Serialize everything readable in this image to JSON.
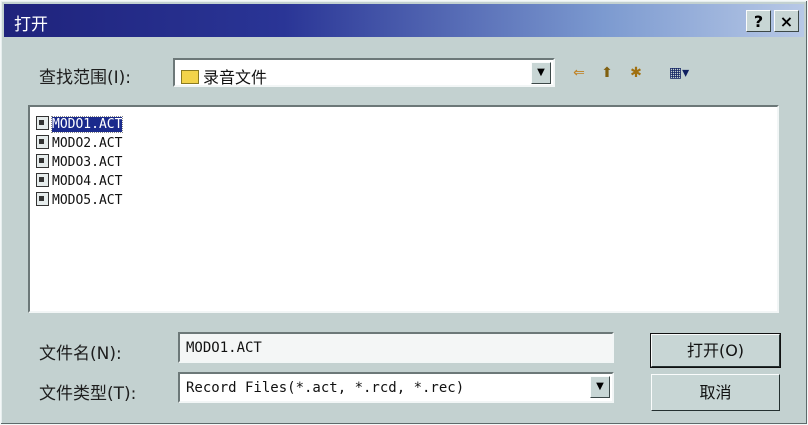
{
  "window": {
    "title": "打开",
    "help_label": "?",
    "close_label": "×"
  },
  "lookin": {
    "label": "查找范围(I):",
    "value": "录音文件",
    "dropdown_glyph": "▼",
    "toolbar": {
      "back_glyph": "⇐",
      "up_glyph": "⬆",
      "newfolder_glyph": "✱",
      "view_glyph": "▦▾"
    }
  },
  "files": [
    {
      "name": "MODO1.ACT",
      "selected": true
    },
    {
      "name": "MODO2.ACT",
      "selected": false
    },
    {
      "name": "MODO3.ACT",
      "selected": false
    },
    {
      "name": "MODO4.ACT",
      "selected": false
    },
    {
      "name": "MODO5.ACT",
      "selected": false
    }
  ],
  "filename": {
    "label": "文件名(N):",
    "value": "MODO1.ACT"
  },
  "filetype": {
    "label": "文件类型(T):",
    "value": "Record Files(*.act, *.rcd, *.rec)",
    "dropdown_glyph": "▼"
  },
  "buttons": {
    "open_label": "打开(O)",
    "cancel_label": "取消"
  },
  "colors": {
    "title_start": "#1f237c",
    "title_end": "#b7c8e6",
    "face": "#c3d1d0",
    "selection": "#1a2a8c"
  }
}
